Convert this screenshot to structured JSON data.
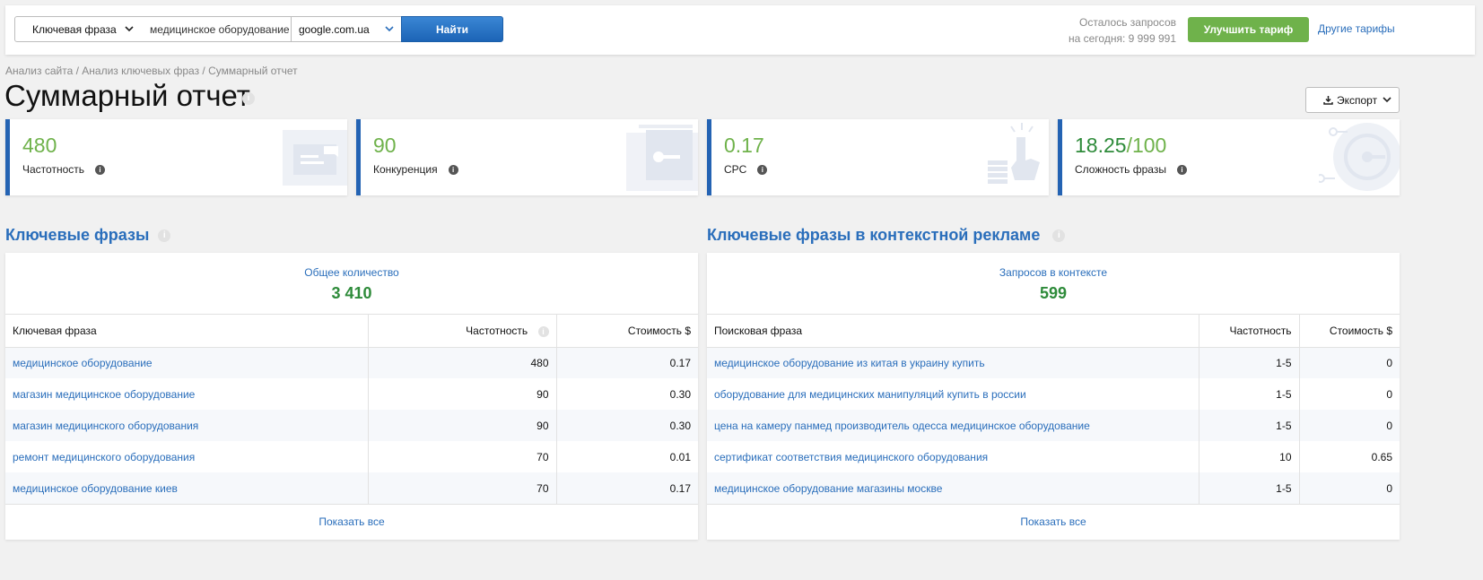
{
  "topbar": {
    "search_type": "Ключевая фраза",
    "search_value": "медицинское оборудование",
    "engine": "google.com.ua",
    "find_label": "Найти",
    "quota_line1": "Осталось запросов",
    "quota_line2": "на сегодня: 9 999 991",
    "upgrade_label": "Улучшить тариф",
    "other_plans_label": "Другие тарифы"
  },
  "breadcrumb": "Анализ сайта / Анализ ключевых фраз / Суммарный отчет",
  "page_title": "Суммарный отчет",
  "export_label": "Экспорт",
  "cards": [
    {
      "value": "480",
      "label": "Частотность"
    },
    {
      "value": "90",
      "label": "Конкуренция"
    },
    {
      "value": "0.17",
      "label": "CPC"
    },
    {
      "value": "18.25",
      "value_suffix": "/100",
      "label": "Сложность фразы"
    }
  ],
  "keywords": {
    "title": "Ключевые фразы",
    "summary_label": "Общее количество",
    "summary_value": "3 410",
    "columns": [
      "Ключевая фраза",
      "Частотность",
      "Стоимость $"
    ],
    "rows": [
      {
        "phrase": "медицинское оборудование",
        "freq": "480",
        "cost": "0.17"
      },
      {
        "phrase": "магазин медицинское оборудование",
        "freq": "90",
        "cost": "0.30"
      },
      {
        "phrase": "магазин медицинского оборудования",
        "freq": "90",
        "cost": "0.30"
      },
      {
        "phrase": "ремонт медицинского оборудования",
        "freq": "70",
        "cost": "0.01"
      },
      {
        "phrase": "медицинское оборудование киев",
        "freq": "70",
        "cost": "0.17"
      }
    ],
    "show_all": "Показать все"
  },
  "ads": {
    "title": "Ключевые фразы в контекстной рекламе",
    "summary_label": "Запросов в контексте",
    "summary_value": "599",
    "columns": [
      "Поисковая фраза",
      "Частотность",
      "Стоимость $"
    ],
    "rows": [
      {
        "phrase": "медицинское оборудование из китая в украину купить",
        "freq": "1-5",
        "cost": "0"
      },
      {
        "phrase": "оборудование для медицинских манипуляций купить в россии",
        "freq": "1-5",
        "cost": "0"
      },
      {
        "phrase": "цена на камеру панмед производитель одесса медицинское оборудование",
        "freq": "1-5",
        "cost": "0"
      },
      {
        "phrase": "сертификат соответствия медицинского оборудования",
        "freq": "10",
        "cost": "0.65"
      },
      {
        "phrase": "медицинское оборудование магазины москве",
        "freq": "1-5",
        "cost": "0"
      }
    ],
    "show_all": "Показать все"
  }
}
